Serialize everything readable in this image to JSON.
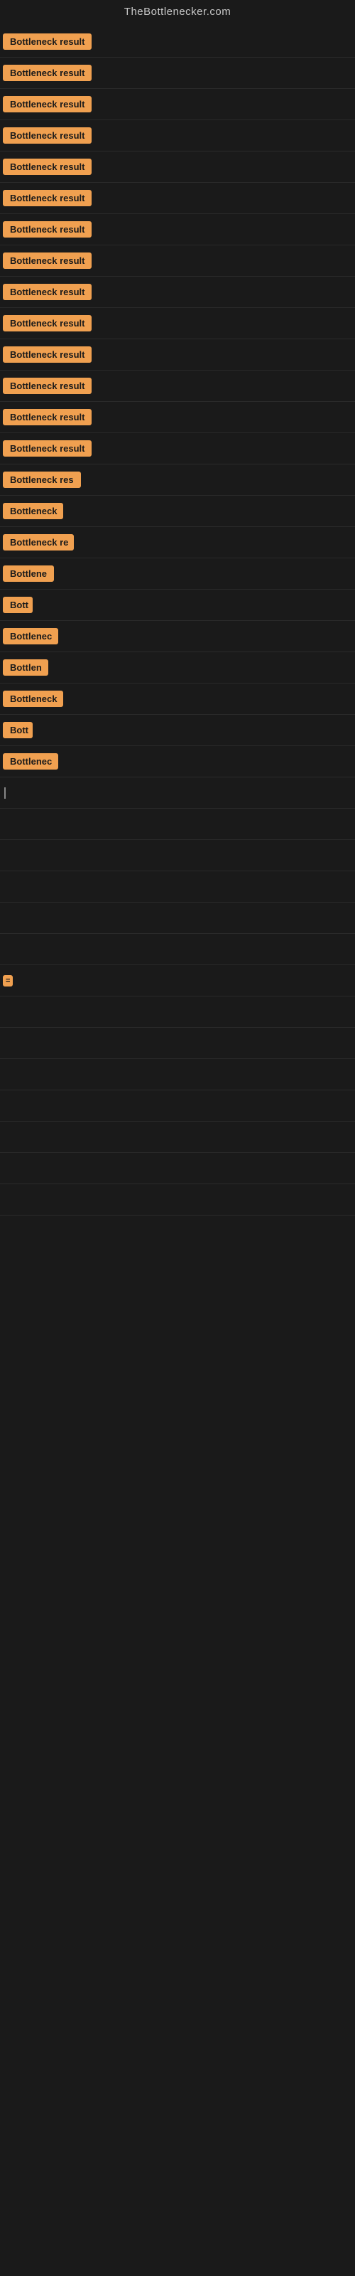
{
  "header": {
    "title": "TheBottlenecker.com"
  },
  "rows": [
    {
      "label": "Bottleneck result",
      "width": 130,
      "visible": true
    },
    {
      "label": "Bottleneck result",
      "width": 130,
      "visible": true
    },
    {
      "label": "Bottleneck result",
      "width": 130,
      "visible": true
    },
    {
      "label": "Bottleneck result",
      "width": 130,
      "visible": true
    },
    {
      "label": "Bottleneck result",
      "width": 130,
      "visible": true
    },
    {
      "label": "Bottleneck result",
      "width": 130,
      "visible": true
    },
    {
      "label": "Bottleneck result",
      "width": 130,
      "visible": true
    },
    {
      "label": "Bottleneck result",
      "width": 130,
      "visible": true
    },
    {
      "label": "Bottleneck result",
      "width": 130,
      "visible": true
    },
    {
      "label": "Bottleneck result",
      "width": 130,
      "visible": true
    },
    {
      "label": "Bottleneck result",
      "width": 130,
      "visible": true
    },
    {
      "label": "Bottleneck result",
      "width": 130,
      "visible": true
    },
    {
      "label": "Bottleneck result",
      "width": 130,
      "visible": true
    },
    {
      "label": "Bottleneck result",
      "width": 130,
      "visible": true
    },
    {
      "label": "Bottleneck res",
      "width": 118,
      "visible": true
    },
    {
      "label": "Bottleneck",
      "width": 85,
      "visible": true
    },
    {
      "label": "Bottleneck re",
      "width": 100,
      "visible": true
    },
    {
      "label": "Bottlene",
      "width": 74,
      "visible": true
    },
    {
      "label": "Bott",
      "width": 42,
      "visible": true
    },
    {
      "label": "Bottlenec",
      "width": 78,
      "visible": true
    },
    {
      "label": "Bottlen",
      "width": 64,
      "visible": true
    },
    {
      "label": "Bottleneck",
      "width": 85,
      "visible": true
    },
    {
      "label": "Bott",
      "width": 42,
      "visible": true
    },
    {
      "label": "Bottlenec",
      "width": 78,
      "visible": true
    },
    {
      "label": "",
      "width": 0,
      "visible": false,
      "cursor": true
    },
    {
      "label": "",
      "width": 0,
      "visible": false
    },
    {
      "label": "",
      "width": 0,
      "visible": false
    },
    {
      "label": "",
      "width": 0,
      "visible": false
    },
    {
      "label": "",
      "width": 0,
      "visible": false
    },
    {
      "label": "",
      "width": 0,
      "visible": false
    },
    {
      "label": "=",
      "width": 14,
      "visible": true,
      "small": true
    },
    {
      "label": "",
      "width": 0,
      "visible": false
    },
    {
      "label": "",
      "width": 0,
      "visible": false
    },
    {
      "label": "",
      "width": 0,
      "visible": false
    },
    {
      "label": "",
      "width": 0,
      "visible": false
    },
    {
      "label": "",
      "width": 0,
      "visible": false
    },
    {
      "label": "",
      "width": 0,
      "visible": false
    },
    {
      "label": "",
      "width": 0,
      "visible": false
    }
  ],
  "badge_color": "#f0a050",
  "bg_color": "#1a1a1a"
}
